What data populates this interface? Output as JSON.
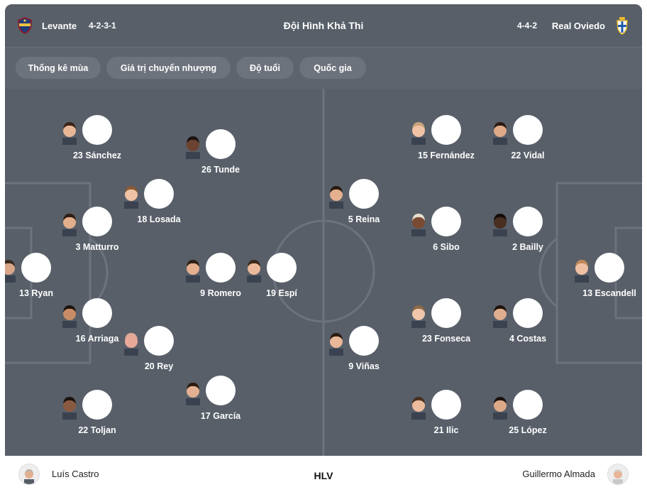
{
  "header": {
    "home_team": "Levante",
    "home_formation": "4-2-3-1",
    "title": "Đội Hình Khả Thi",
    "away_formation": "4-4-2",
    "away_team": "Real Oviedo"
  },
  "filters": [
    "Thống kê mùa",
    "Giá trị chuyển nhượng",
    "Độ tuổi",
    "Quốc gia"
  ],
  "home_players": [
    {
      "label": "23 Sánchez",
      "skin": "#e8b796",
      "hair": "#3a2418"
    },
    {
      "label": "26 Tunde",
      "skin": "#6b4330",
      "hair": "#1b1310"
    },
    {
      "label": "18 Losada",
      "skin": "#efc3a4",
      "hair": "#8a5a35"
    },
    {
      "label": "3 Matturro",
      "skin": "#e2ae8c",
      "hair": "#2e1d12"
    },
    {
      "label": "13 Ryan",
      "skin": "#d9a688",
      "hair": "#3a2a20"
    },
    {
      "label": "9 Romero",
      "skin": "#e6b090",
      "hair": "#2f1f14"
    },
    {
      "label": "19 Espí",
      "skin": "#ebb99b",
      "hair": "#3b2819"
    },
    {
      "label": "16 Arriaga",
      "skin": "#c88d66",
      "hair": "#1e140e"
    },
    {
      "label": "20 Rey",
      "skin": "#e8a999",
      "hair": "#e0a898"
    },
    {
      "label": "17 García",
      "skin": "#e3b092",
      "hair": "#2a1a10"
    },
    {
      "label": "22 Toljan",
      "skin": "#8a5a40",
      "hair": "#1a120e"
    }
  ],
  "away_players": [
    {
      "label": "15 Fernández",
      "skin": "#f0c2a6",
      "hair": "#c9a27a"
    },
    {
      "label": "22 Vidal",
      "skin": "#deaa88",
      "hair": "#2b1b12"
    },
    {
      "label": "5 Reina",
      "skin": "#e4b090",
      "hair": "#2a1a10"
    },
    {
      "label": "6 Sibo",
      "skin": "#7a4a32",
      "hair": "#e8e0d0"
    },
    {
      "label": "2 Bailly",
      "skin": "#4a2e22",
      "hair": "#120c08"
    },
    {
      "label": "13 Escandell",
      "skin": "#f0c0a4",
      "hair": "#c08a58"
    },
    {
      "label": "23 Fonseca",
      "skin": "#efc6aa",
      "hair": "#8c6a48"
    },
    {
      "label": "4 Costas",
      "skin": "#e0ae8e",
      "hair": "#20140c"
    },
    {
      "label": "9 Viñas",
      "skin": "#e9b898",
      "hair": "#2c1c12"
    },
    {
      "label": "21 Ilic",
      "skin": "#ecbc9e",
      "hair": "#4a3020"
    },
    {
      "label": "25 López",
      "skin": "#dcaa88",
      "hair": "#1c120c"
    }
  ],
  "footer": {
    "home_coach": "Luís Castro",
    "label": "HLV",
    "away_coach": "Guillermo Almada"
  }
}
